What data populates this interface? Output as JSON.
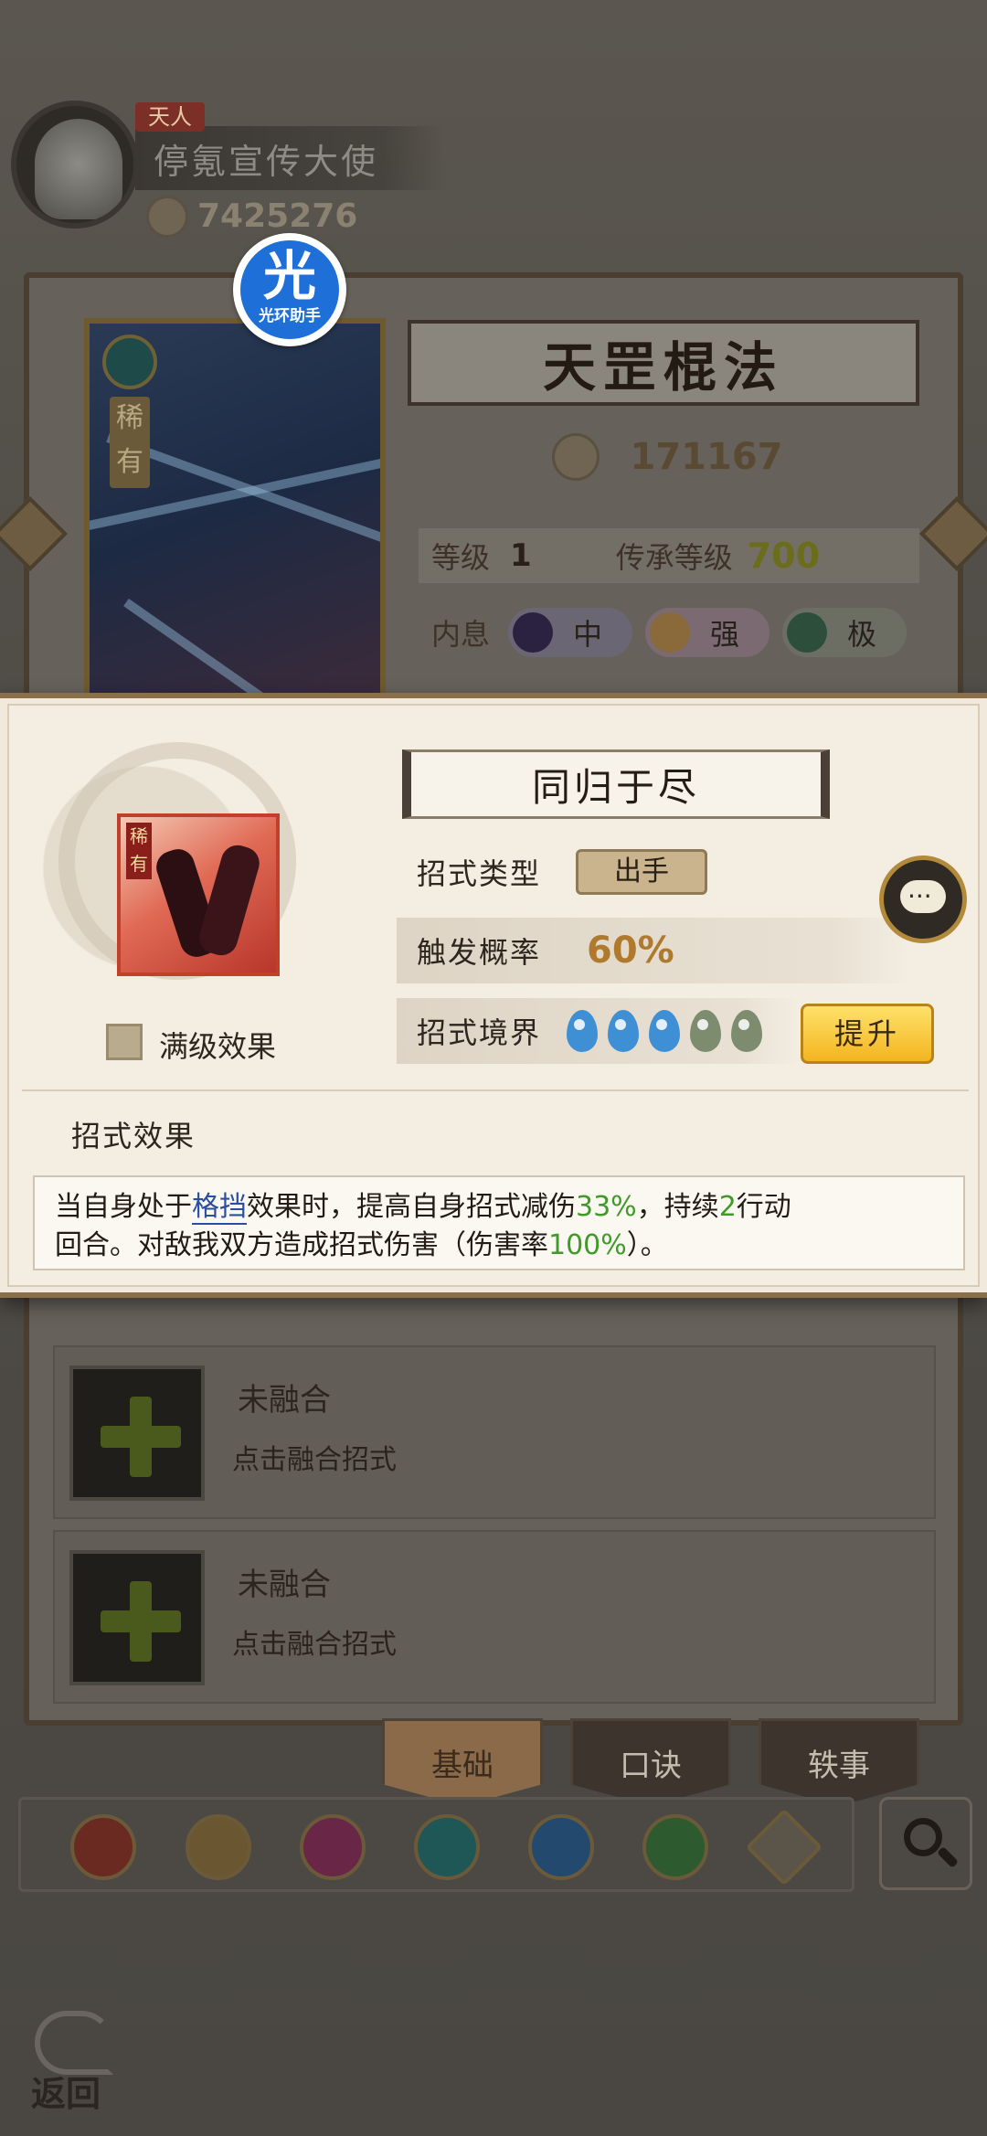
{
  "player": {
    "rank_badge": "天人",
    "name": "停氪宣传大使",
    "power": "7425276"
  },
  "overlay_badge": {
    "glyph": "光",
    "label": "光环助手"
  },
  "skill_card": {
    "title": "天罡棍法",
    "rarity_label": "稀有",
    "power": "171167",
    "level_label": "等级",
    "level": "1",
    "inherit_label": "传承等级",
    "inherit_level": "700",
    "neixi_label": "内息",
    "neixi_options": [
      "中",
      "强",
      "极"
    ]
  },
  "fusion_slots": [
    {
      "title": "未融合",
      "subtitle": "点击融合招式"
    },
    {
      "title": "未融合",
      "subtitle": "点击融合招式"
    }
  ],
  "tabs": [
    "基础",
    "口诀",
    "轶事"
  ],
  "category_icons": [
    "sword-icon",
    "dagger-icon",
    "fist-icon",
    "fan-icon",
    "yinyang-icon",
    "hidden-weapon-icon",
    "misc-icon"
  ],
  "popup": {
    "title": "同归于尽",
    "icon_rarity": "稀有",
    "max_level_label": "满级效果",
    "type_label": "招式类型",
    "type_value": "出手",
    "rate_label": "触发概率",
    "rate_value": "60%",
    "realm_label": "招式境界",
    "realm_level": 3,
    "realm_max": 5,
    "upgrade_label": "提升",
    "effect_header": "招式效果",
    "effect": {
      "p1": "当自身处于",
      "link": "格挡",
      "p2": "效果时，提高自身招式减伤",
      "v1": "33%",
      "p3": "，持续",
      "v2": "2",
      "p4": "行动",
      "line2_a": "回合。对敌我双方造成招式伤害（伤害率",
      "v3": "100%",
      "line2_b": "）。"
    }
  },
  "back_label": "返回",
  "colors": {
    "upgrade_button": "#f3b520",
    "highlight_green": "#3f9a2a",
    "highlight_blue": "#2a4f9f",
    "realm_on": "#3f8fd4",
    "realm_off": "#7d8c6e"
  }
}
